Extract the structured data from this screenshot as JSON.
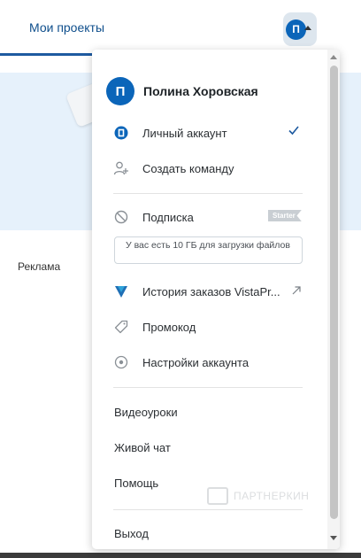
{
  "header": {
    "tab_projects": "Мои проекты",
    "avatar_initial": "П"
  },
  "background": {
    "ad_label": "Реклама"
  },
  "menu": {
    "user": {
      "initial": "П",
      "name": "Полина Хоровская"
    },
    "personal_account": "Личный аккаунт",
    "create_team": "Создать команду",
    "subscription": "Подписка",
    "subscription_badge": "Starter",
    "storage_note": "У вас есть 10 ГБ для загрузки файлов",
    "order_history": "История заказов VistaPr...",
    "promo_code": "Промокод",
    "account_settings": "Настройки аккаунта",
    "video_lessons": "Видеоуроки",
    "live_chat": "Живой чат",
    "help": "Помощь",
    "logout": "Выход",
    "watermark": "ПАРТНЕРКИН"
  },
  "colors": {
    "accent": "#0b65b9",
    "tab_text": "#0f4f8c",
    "hero_bg": "#e6f1fb"
  },
  "icons": {
    "personal_account": "account-circle-icon",
    "create_team": "add-person-icon",
    "subscription": "no-entry-icon",
    "order_history": "vistaprint-logo-icon",
    "promo_code": "tag-icon",
    "account_settings": "settings-icon"
  }
}
